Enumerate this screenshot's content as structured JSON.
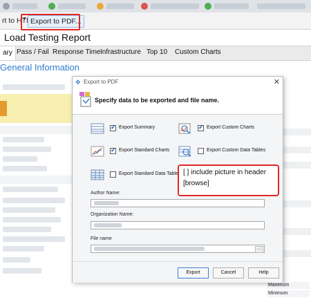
{
  "toolbar": {
    "export_html": "rt to HTML",
    "export_pdf": "Export to PDF..."
  },
  "report": {
    "title": "Load Testing Report",
    "tabs": [
      "ary",
      "Pass / Fail",
      "Response Time",
      "Infrastructure",
      "Top 10",
      "Custom Charts"
    ],
    "section_title": "General Information"
  },
  "dialog": {
    "window_title": "Export to PDF",
    "header_text": "Specify data to be exported and file name.",
    "options": [
      {
        "label": "Export Summary",
        "checked": true,
        "icon": "summary-table-icon"
      },
      {
        "label": "Export Custom Charts",
        "checked": true,
        "icon": "chart-magnifier-icon"
      },
      {
        "label": "Export Standard Charts",
        "checked": true,
        "icon": "line-chart-icon"
      },
      {
        "label": "Export Custom Data Tables",
        "checked": false,
        "icon": "table-magnifier-icon"
      },
      {
        "label": "Export Standard Data Tables",
        "checked": false,
        "icon": "grid-table-icon"
      }
    ],
    "author_label": "Author Name:",
    "org_label": "Organization Name:",
    "file_label": "File name",
    "buttons": {
      "export": "Export",
      "cancel": "Cancel",
      "help": "Help"
    }
  },
  "callout": {
    "line1": "[ ] include picture in header",
    "line2": "[browse]"
  },
  "side_labels": {
    "maximum": "Maximum",
    "minimum": "Minimum"
  },
  "colors": {
    "accent_blue": "#2e7dd0",
    "callout_red": "#e02828",
    "notice_yellow": "#f6efb0"
  }
}
